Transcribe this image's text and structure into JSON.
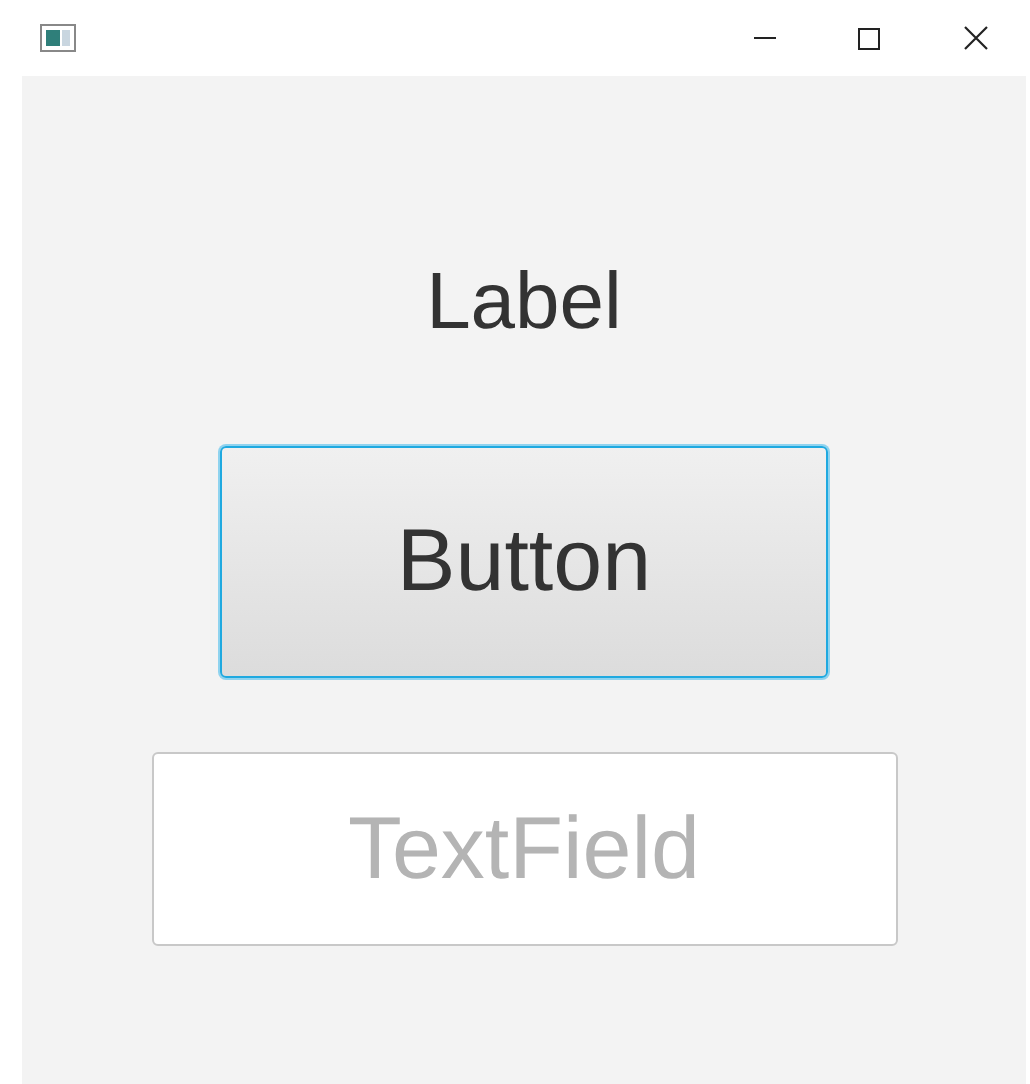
{
  "label": "Label",
  "button": {
    "label": "Button",
    "focused": true
  },
  "text_field": {
    "placeholder": "TextField"
  }
}
